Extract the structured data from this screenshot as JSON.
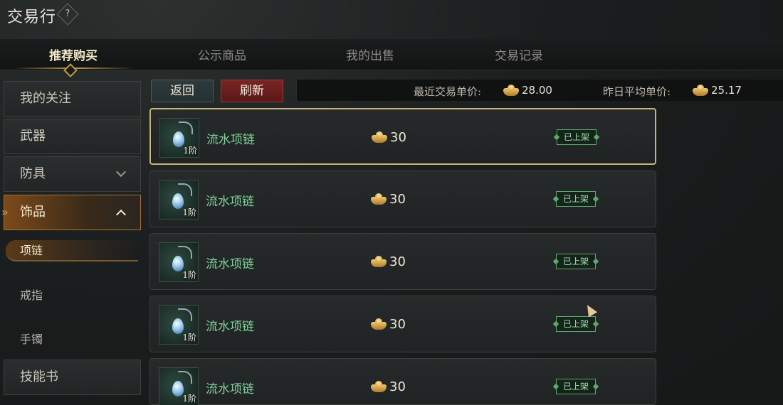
{
  "header": {
    "title": "交易行",
    "help_glyph": "?"
  },
  "tabs": [
    {
      "label": "推荐购买"
    },
    {
      "label": "公示商品"
    },
    {
      "label": "我的出售"
    },
    {
      "label": "交易记录"
    }
  ],
  "sidebar": {
    "categories": [
      {
        "label": "我的关注"
      },
      {
        "label": "武器"
      },
      {
        "label": "防具"
      },
      {
        "label": "饰品"
      },
      {
        "label": "技能书"
      }
    ],
    "subcategories": [
      {
        "label": "项链"
      },
      {
        "label": "戒指"
      },
      {
        "label": "手镯"
      }
    ]
  },
  "toolbar": {
    "back_label": "返回",
    "refresh_label": "刷新",
    "recent_price_label": "最近交易单价:",
    "recent_price_value": "28.00",
    "avg_price_label": "昨日平均单价:",
    "avg_price_value": "25.17"
  },
  "listings": [
    {
      "name": "流水项链",
      "tier": "1阶",
      "price": "30",
      "status": "已上架"
    },
    {
      "name": "流水项链",
      "tier": "1阶",
      "price": "30",
      "status": "已上架"
    },
    {
      "name": "流水项链",
      "tier": "1阶",
      "price": "30",
      "status": "已上架"
    },
    {
      "name": "流水项链",
      "tier": "1阶",
      "price": "30",
      "status": "已上架"
    },
    {
      "name": "流水项链",
      "tier": "1阶",
      "price": "30",
      "status": "已上架"
    }
  ],
  "colors": {
    "accent_gold": "#c89a46",
    "item_green": "#7ed29a",
    "refresh_red": "#7a2424"
  },
  "icons": [
    "help-icon",
    "gold-ingot-icon",
    "necklace-icon",
    "chevron-down-icon",
    "chevron-up-icon"
  ]
}
